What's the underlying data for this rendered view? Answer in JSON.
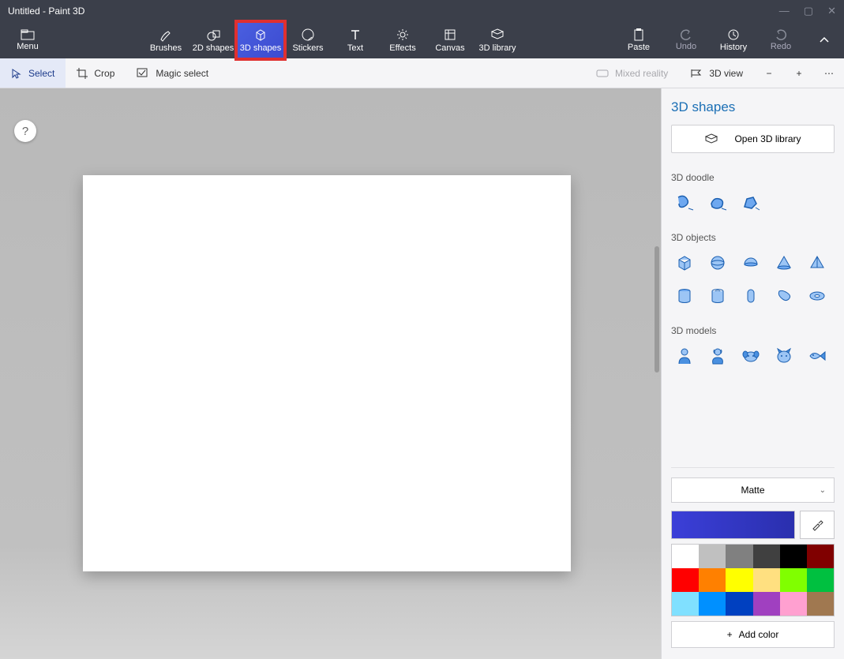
{
  "window": {
    "title": "Untitled - Paint 3D"
  },
  "ribbon": {
    "menu": "Menu",
    "tools": [
      {
        "label": "Brushes",
        "icon": "brush"
      },
      {
        "label": "2D shapes",
        "icon": "2d"
      },
      {
        "label": "3D shapes",
        "icon": "3d",
        "active": true,
        "highlight": true
      },
      {
        "label": "Stickers",
        "icon": "sticker"
      },
      {
        "label": "Text",
        "icon": "text"
      },
      {
        "label": "Effects",
        "icon": "effects"
      },
      {
        "label": "Canvas",
        "icon": "canvas"
      },
      {
        "label": "3D library",
        "icon": "library"
      }
    ],
    "actions": {
      "paste": "Paste",
      "undo": "Undo",
      "history": "History",
      "redo": "Redo"
    }
  },
  "toolbar": {
    "select": "Select",
    "crop": "Crop",
    "magic_select": "Magic select",
    "mixed_reality": "Mixed reality",
    "view3d": "3D view"
  },
  "panel": {
    "title": "3D shapes",
    "open_library": "Open 3D library",
    "sections": {
      "doodle": "3D doodle",
      "objects": "3D objects",
      "models": "3D models"
    },
    "material": "Matte",
    "add_color": "Add color",
    "palette": [
      "#ffffff",
      "#c0c0c0",
      "#808080",
      "#404040",
      "#000000",
      "#800000",
      "#ff0000",
      "#ff8000",
      "#ffff00",
      "#ffe080",
      "#80ff00",
      "#00c040",
      "#80e0ff",
      "#0090ff",
      "#0040c0",
      "#a040c0",
      "#ffa0d0",
      "#a07850"
    ],
    "current_color": "#3b3fd8"
  }
}
